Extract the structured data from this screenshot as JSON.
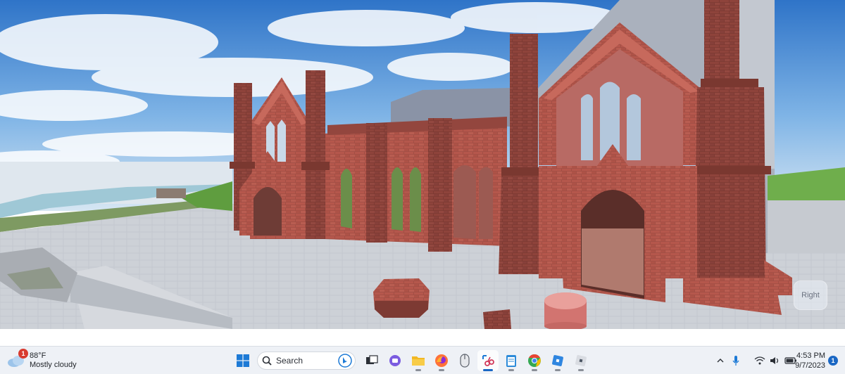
{
  "viewport": {
    "view_cube_label": "Right"
  },
  "taskbar": {
    "weather": {
      "badge": "1",
      "temperature": "88°F",
      "condition": "Mostly cloudy"
    },
    "search": {
      "placeholder": "Search"
    },
    "pinned_apps": [
      {
        "name": "start-button",
        "icon": "windows-logo"
      },
      {
        "name": "search",
        "icon": "search-icon"
      },
      {
        "name": "task-view",
        "icon": "task-view-icon"
      },
      {
        "name": "teams-chat",
        "icon": "chat-icon"
      },
      {
        "name": "file-explorer",
        "icon": "folder-icon"
      },
      {
        "name": "firefox",
        "icon": "firefox-icon"
      },
      {
        "name": "mouse-app",
        "icon": "mouse-icon"
      },
      {
        "name": "snipping-tool",
        "icon": "snipping-icon"
      },
      {
        "name": "notepad",
        "icon": "notepad-icon"
      },
      {
        "name": "chrome",
        "icon": "chrome-icon"
      },
      {
        "name": "roblox-player",
        "icon": "roblox-icon"
      },
      {
        "name": "roblox-studio",
        "icon": "roblox-studio-icon"
      }
    ],
    "tray": {
      "time": "4:53 PM",
      "date": "9/7/2023",
      "notification_count": "1"
    }
  }
}
